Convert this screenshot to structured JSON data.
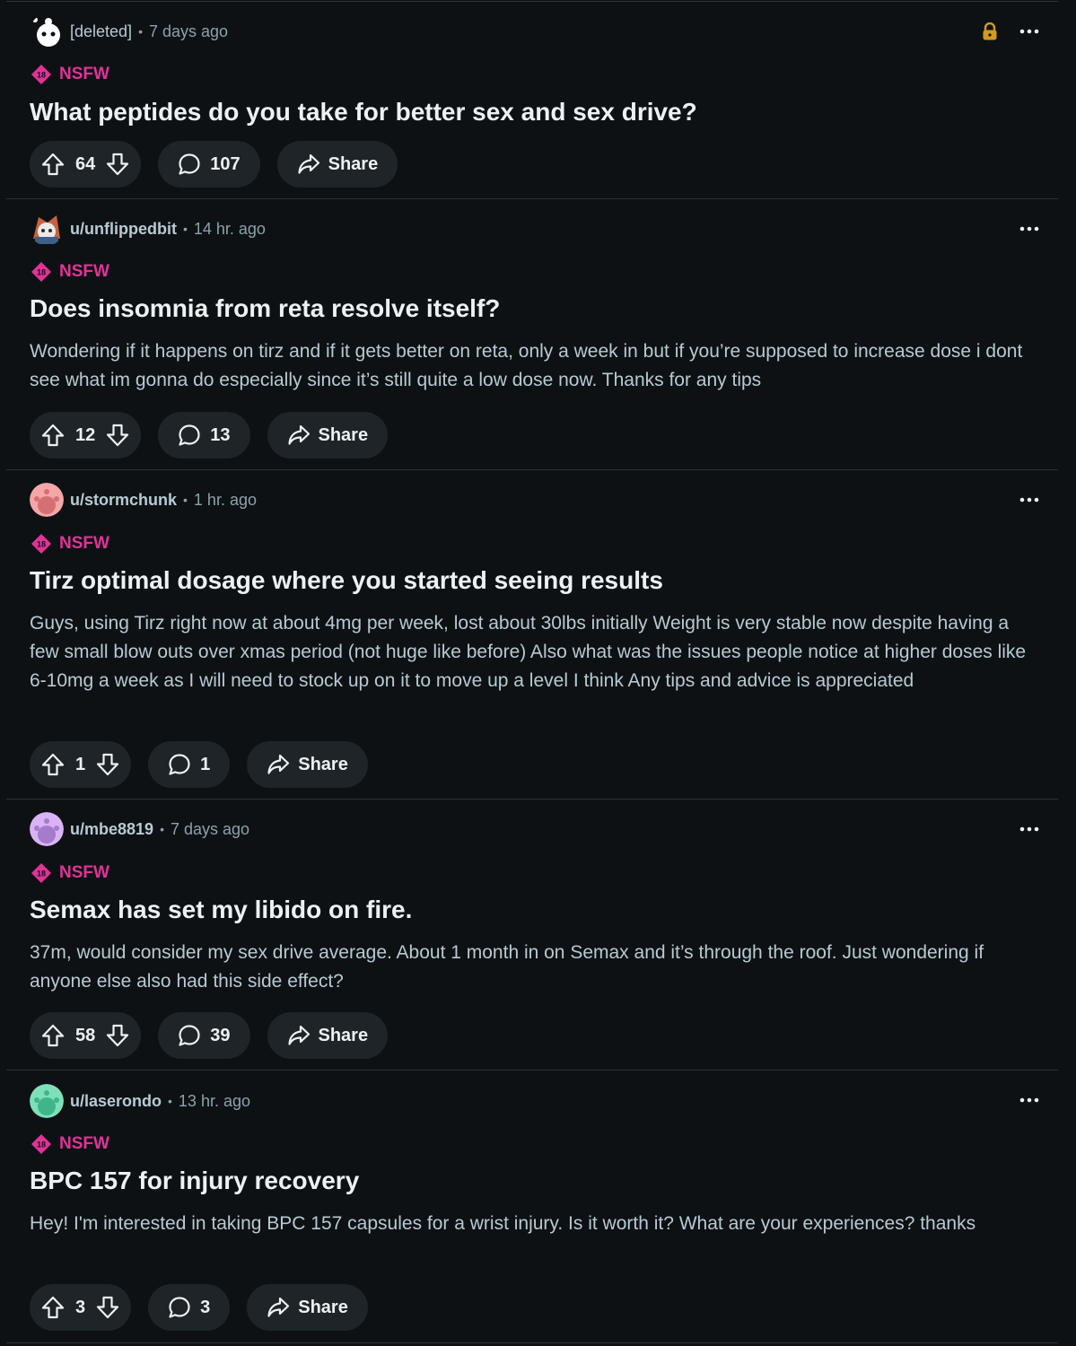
{
  "posts": [
    {
      "username": "[deleted]",
      "time": "7 days ago",
      "locked": true,
      "tag": "NSFW",
      "tag_icon_text": "18",
      "title": "What peptides do you take for better sex and sex drive?",
      "body": "",
      "votes": "64",
      "comments": "107",
      "share_label": "Share",
      "avatar_color": "#ffffff"
    },
    {
      "username": "u/unflippedbit",
      "time": "14 hr. ago",
      "locked": false,
      "tag": "NSFW",
      "tag_icon_text": "18",
      "title": "Does insomnia from reta resolve itself?",
      "body": "Wondering if it happens on tirz and if it gets better on reta, only a week in but if you’re supposed to increase dose i dont see what im gonna do especially since it’s still quite a low dose now. Thanks for any tips",
      "votes": "12",
      "comments": "13",
      "share_label": "Share",
      "avatar_color": "#c8643c"
    },
    {
      "username": "u/stormchunk",
      "time": "1 hr. ago",
      "locked": false,
      "tag": "NSFW",
      "tag_icon_text": "18",
      "title": "Tirz optimal dosage where you started seeing results",
      "body": "Guys, using Tirz right now at about 4mg per week, lost about 30lbs initially Weight is very stable now despite having a few small blow outs over xmas period (not huge like before) Also what was the issues people notice at higher doses like 6-10mg a week as I will need to stock up on it to move up a level I think Any tips and advice is appreciated",
      "votes": "1",
      "comments": "1",
      "share_label": "Share",
      "avatar_color": "#f3a7a7"
    },
    {
      "username": "u/mbe8819",
      "time": "7 days ago",
      "locked": false,
      "tag": "NSFW",
      "tag_icon_text": "18",
      "title": "Semax has set my libido on fire.",
      "body": "37m, would consider my sex drive average. About 1 month in on Semax and it’s through the roof. Just wondering if anyone else also had this side effect?",
      "votes": "58",
      "comments": "39",
      "share_label": "Share",
      "avatar_color": "#d9b3f5"
    },
    {
      "username": "u/laserondo",
      "time": "13 hr. ago",
      "locked": false,
      "tag": "NSFW",
      "tag_icon_text": "18",
      "title": "BPC 157 for injury recovery",
      "body": "Hey! I'm interested in taking BPC 157 capsules for a wrist injury. Is it worth it? What are your experiences? thanks",
      "votes": "3",
      "comments": "3",
      "share_label": "Share",
      "avatar_color": "#7ee0b8"
    }
  ],
  "icons": {
    "upvote": "upvote-icon",
    "downvote": "downvote-icon",
    "comment": "comment-icon",
    "share": "share-icon",
    "more": "more-options-icon",
    "lock": "lock-icon",
    "nsfw": "nsfw-18-icon"
  },
  "colors": {
    "background": "#0e1113",
    "pill": "#1e2428",
    "nsfw": "#e2329a",
    "lock": "#d39a1f",
    "title": "#eef1f3",
    "text": "#b7cad4",
    "muted": "#8ba2ad"
  }
}
